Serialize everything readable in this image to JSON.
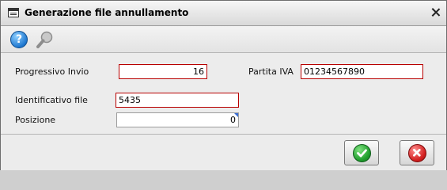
{
  "window": {
    "title": "Generazione file annullamento"
  },
  "toolbar": {
    "icons": [
      "help-icon",
      "search-icon"
    ]
  },
  "form": {
    "progressivo_label": "Progressivo Invio",
    "progressivo_value": "16",
    "partita_label": "Partita IVA",
    "partita_value": "01234567890",
    "identificativo_label": "Identificativo file",
    "identificativo_value": "5435",
    "posizione_label": "Posizione",
    "posizione_value": "0"
  },
  "footer": {
    "ok_icon": "check-icon",
    "cancel_icon": "cancel-icon"
  },
  "colors": {
    "required_border": "#b80000",
    "ok_green": "#1f9e2c",
    "cancel_red": "#d32020",
    "help_blue": "#1f78d0"
  }
}
